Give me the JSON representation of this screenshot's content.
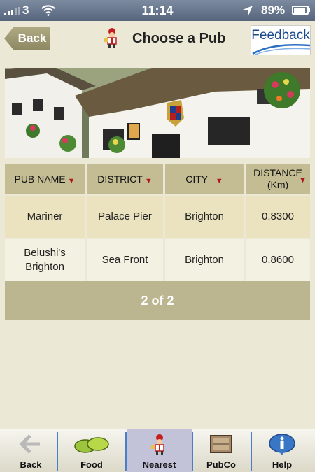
{
  "status_bar": {
    "carrier": "3",
    "time": "11:14",
    "battery": "89%",
    "battery_level": 0.89
  },
  "header": {
    "back_label": "Back",
    "title": "Choose a Pub",
    "feedback_label": "Feedback"
  },
  "table": {
    "columns": [
      {
        "label": "PUB NAME"
      },
      {
        "label": "DISTRICT"
      },
      {
        "label": "CITY"
      },
      {
        "label": "DISTANCE",
        "sublabel": "(Km)"
      }
    ],
    "rows": [
      {
        "pub_name": "Mariner",
        "district": "Palace Pier",
        "city": "Brighton",
        "distance": "0.8300"
      },
      {
        "pub_name": "Belushi's Brighton",
        "district": "Sea Front",
        "city": "Brighton",
        "distance": "0.8600"
      }
    ],
    "pager": "2 of 2"
  },
  "tabbar": {
    "tabs": [
      {
        "label": "Back",
        "icon": "back-arrow-icon"
      },
      {
        "label": "Food",
        "icon": "food-icon"
      },
      {
        "label": "Nearest",
        "icon": "mascot-icon",
        "active": true
      },
      {
        "label": "PubCo",
        "icon": "pub-sign-icon"
      },
      {
        "label": "Help",
        "icon": "info-icon"
      }
    ]
  },
  "colors": {
    "header_cell": "#c4bd94",
    "row_highlight": "#ebe3c0",
    "pager": "#bcb690",
    "active_tab": "#c2c2d8",
    "sort_arrow": "#b01818"
  }
}
